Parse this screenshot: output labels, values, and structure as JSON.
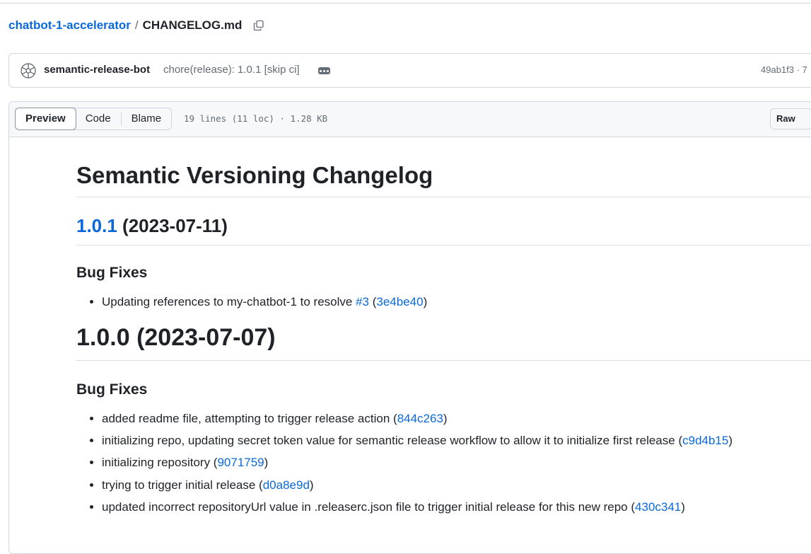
{
  "breadcrumb": {
    "repo": "chatbot-1-accelerator",
    "separator": "/",
    "file": "CHANGELOG.md"
  },
  "commit": {
    "author": "semantic-release-bot",
    "message": "chore(release): 1.0.1 [skip ci]",
    "sha": "49ab1f3 · 7"
  },
  "file_header": {
    "tabs": [
      {
        "label": "Preview",
        "active": true
      },
      {
        "label": "Code",
        "active": false
      },
      {
        "label": "Blame",
        "active": false
      }
    ],
    "info": "19 lines (11 loc) · 1.28 KB",
    "raw_label": "Raw"
  },
  "markdown": {
    "title": "Semantic Versioning Changelog",
    "release_1": {
      "version": "1.0.1",
      "date": " (2023-07-11)",
      "section": "Bug Fixes",
      "items": [
        {
          "text": "Updating references to my-chatbot-1 to resolve ",
          "issue": "#3",
          "open": " (",
          "commit": "3e4be40",
          "close": ")"
        }
      ]
    },
    "release_2": {
      "heading": "1.0.0 (2023-07-07)",
      "section": "Bug Fixes",
      "items": [
        {
          "text": "added readme file, attempting to trigger release action (",
          "commit": "844c263",
          "close": ")"
        },
        {
          "text": "initializing repo, updating secret token value for semantic release workflow to allow it to initialize first release (",
          "commit": "c9d4b15",
          "close": ")"
        },
        {
          "text": "initializing repository (",
          "commit": "9071759",
          "close": ")"
        },
        {
          "text": "trying to trigger initial release (",
          "commit": "d0a8e9d",
          "close": ")"
        },
        {
          "text": "updated incorrect repositoryUrl value in .releaserc.json file to trigger initial release for this new repo (",
          "commit": "430c341",
          "close": ")"
        }
      ]
    }
  },
  "colors": {
    "link": "#0969da",
    "muted": "#636c76",
    "border": "#d0d7de"
  },
  "icons": {
    "copy": "copy-icon",
    "avatar": "bot-avatar-icon",
    "ellipsis": "ellipsis-icon"
  }
}
